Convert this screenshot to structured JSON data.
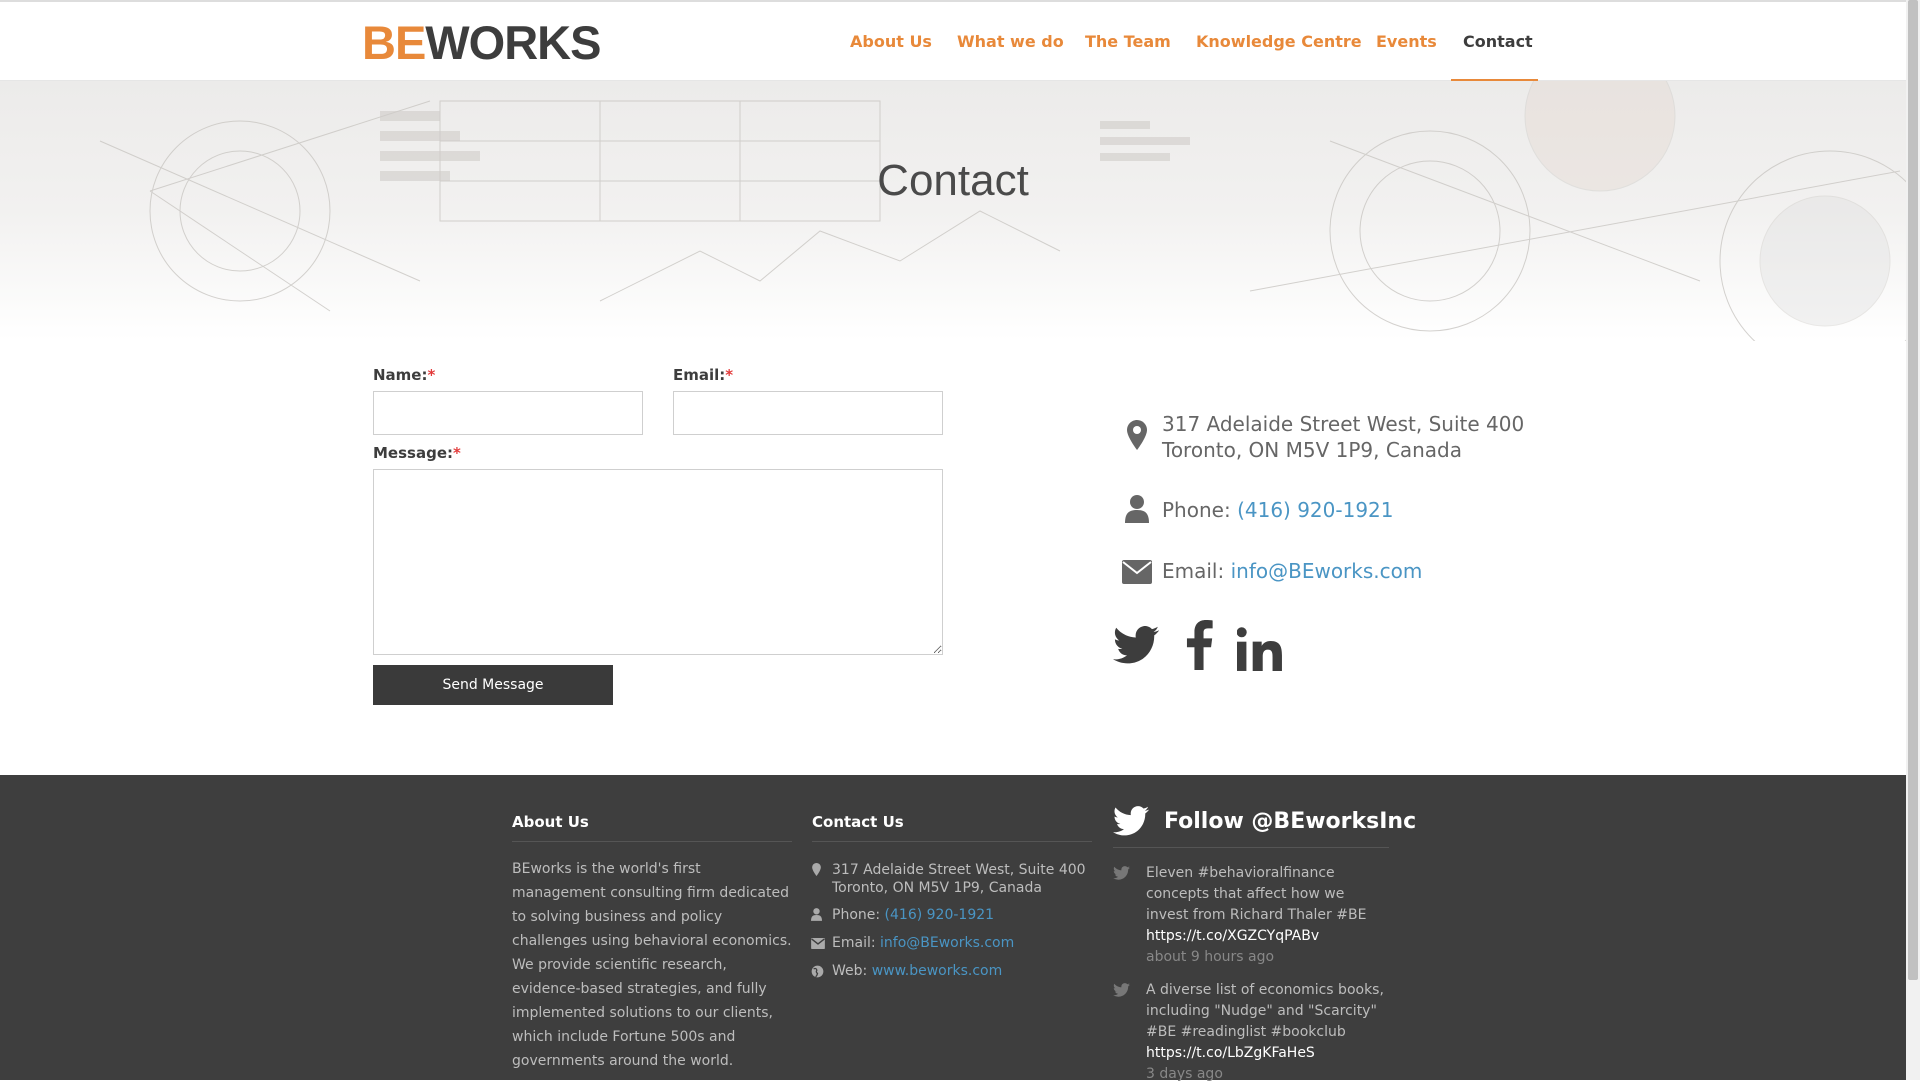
{
  "brand": {
    "logo_be": "BE",
    "logo_works": "WORKS"
  },
  "nav": {
    "items": [
      "About Us",
      "What we do",
      "The Team",
      "Knowledge Centre",
      "Events",
      "Contact"
    ],
    "active": "Contact"
  },
  "hero": {
    "title": "Contact"
  },
  "form": {
    "name_label": "Name:",
    "email_label": "Email:",
    "message_label": "Message:",
    "required_mark": "*",
    "name_value": "",
    "email_value": "",
    "message_value": "",
    "submit_label": "Send Message"
  },
  "contact": {
    "address_line1": "317 Adelaide Street West, Suite 400",
    "address_line2": "Toronto, ON M5V 1P9, Canada",
    "phone_label": "Phone:",
    "phone": "(416) 920-1921",
    "email_label": "Email:",
    "email": "info@BEworks.com",
    "social": [
      "twitter-icon",
      "facebook-icon",
      "linkedin-icon"
    ]
  },
  "footer": {
    "about_heading": "About Us",
    "about_text": "BEworks is the world's first management consulting firm dedicated to solving business and policy challenges using behavioral economics. We provide scientific research, evidence-based strategies, and fully implemented solutions to our clients, which include Fortune 500s and governments around the world.",
    "contact_heading": "Contact Us",
    "address_line1": "317 Adelaide Street West, Suite 400",
    "address_line2": "Toronto, ON M5V 1P9, Canada",
    "phone_label": "Phone:",
    "phone": "(416) 920-1921",
    "email_label": "Email:",
    "email": "info@BEworks.com",
    "web_label": "Web:",
    "web": "www.beworks.com",
    "follow_heading": "Follow @BEworksInc",
    "tweets": [
      {
        "text": "Eleven #behavioralfinance concepts that affect how we invest from Richard Thaler #BE",
        "url": "https://t.co/XGZCYqPABv",
        "time": "about 9 hours ago"
      },
      {
        "text": "A diverse list of economics books, including \"Nudge\" and \"Scarcity\" #BE #readinglist #bookclub",
        "url": "https://t.co/LbZgKFaHeS",
        "time": "3 days ago"
      }
    ]
  },
  "colors": {
    "accent": "#e8893a",
    "dark": "#3d3d3d",
    "link": "#4a95c4",
    "footer_bg": "#3e3e3e"
  }
}
